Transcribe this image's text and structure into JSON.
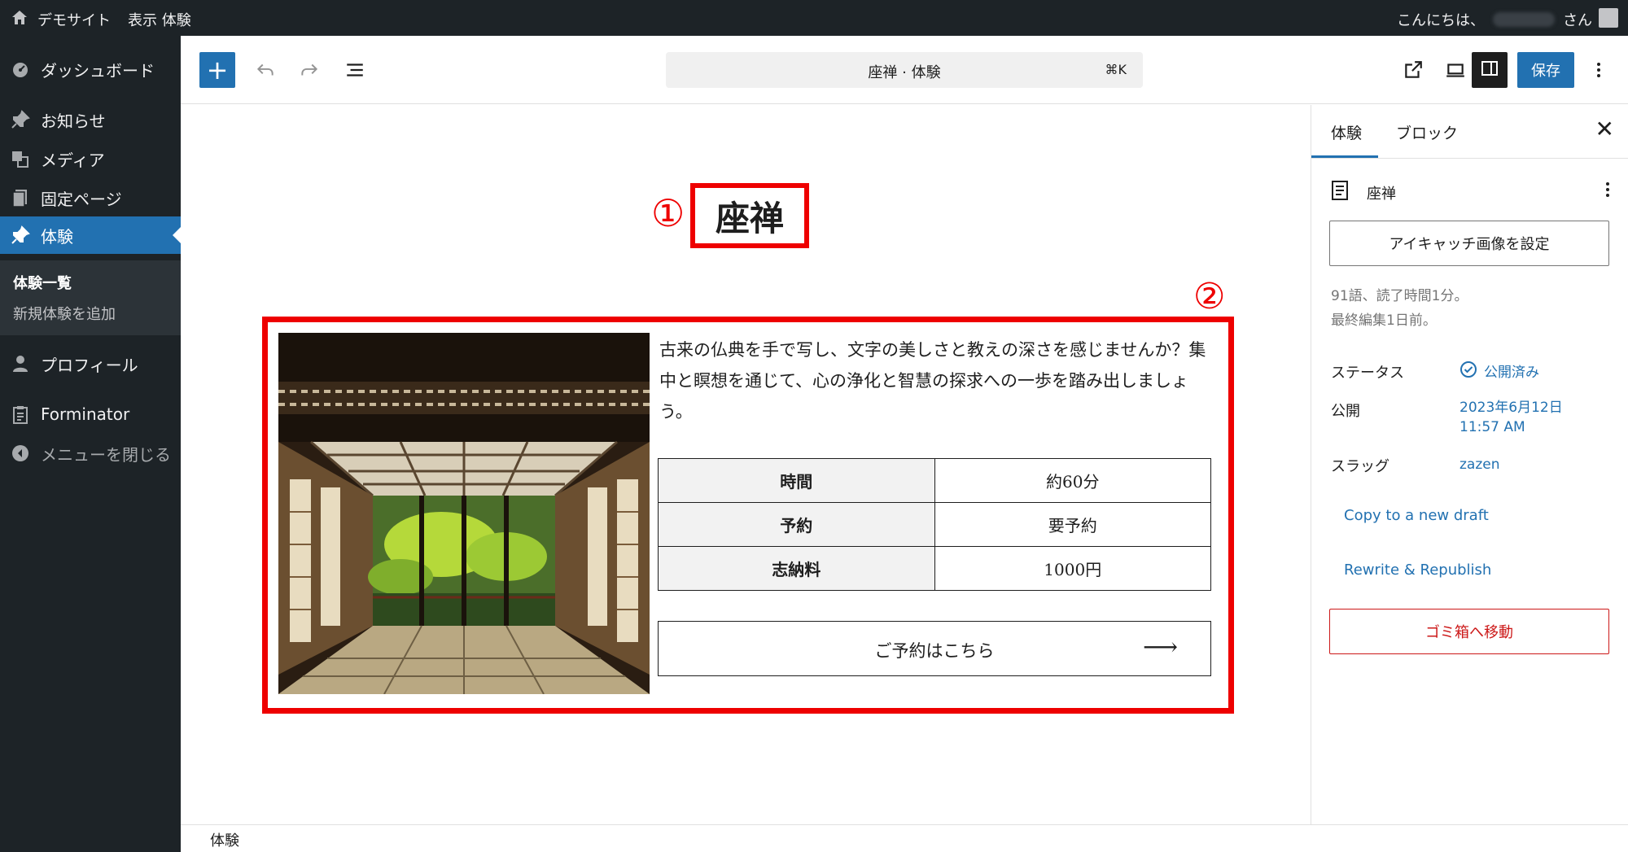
{
  "admin_bar": {
    "site_name": "デモサイト",
    "view_link": "表示 体験",
    "greeting_prefix": "こんにちは、",
    "greeting_suffix": "さん"
  },
  "sidebar": {
    "items": [
      {
        "label": "ダッシュボード",
        "icon": "dashboard-icon"
      },
      {
        "label": "お知らせ",
        "icon": "pin-icon"
      },
      {
        "label": "メディア",
        "icon": "media-icon"
      },
      {
        "label": "固定ページ",
        "icon": "pages-icon"
      },
      {
        "label": "体験",
        "icon": "pin-icon"
      },
      {
        "label": "プロフィール",
        "icon": "user-icon"
      },
      {
        "label": "Forminator",
        "icon": "clipboard-icon"
      },
      {
        "label": "メニューを閉じる",
        "icon": "collapse-icon"
      }
    ],
    "submenu": {
      "item1": "体験一覧",
      "item2": "新規体験を追加"
    }
  },
  "toolbar": {
    "add_label": "+",
    "command_title": "座禅 · 体験",
    "command_shortcut": "⌘K",
    "save_label": "保存"
  },
  "canvas": {
    "marker1": "①",
    "marker2": "②",
    "post_title": "座禅",
    "intro_text": "古来の仏典を手で写し、文字の美しさと教えの深さを感じませんか？集中と瞑想を通じて、心の浄化と智慧の探求への一歩を踏み出しましょう。",
    "table": [
      {
        "key": "時間",
        "value": "約60分"
      },
      {
        "key": "予約",
        "value": "要予約"
      },
      {
        "key": "志納料",
        "value": "1000円"
      }
    ],
    "reserve_label": "ご予約はこちら",
    "reserve_arrow": "⟶"
  },
  "footer": {
    "breadcrumb": "体験"
  },
  "settings": {
    "tab1": "体験",
    "tab2": "ブロック",
    "close": "✕",
    "doc_title": "座禅",
    "featured_image_btn": "アイキャッチ画像を設定",
    "meta_line1": "91語、読了時間1分。",
    "meta_line2": "最終編集1日前。",
    "status_label": "ステータス",
    "status_value": "公開済み",
    "publish_label": "公開",
    "publish_date": "2023年6月12日",
    "publish_time": "11:57 AM",
    "slug_label": "スラッグ",
    "slug_value": "zazen",
    "copy_draft": "Copy to a new draft",
    "rewrite": "Rewrite & Republish",
    "trash": "ゴミ箱へ移動"
  },
  "colors": {
    "accent": "#2271b1",
    "admin_bg": "#1d2327",
    "annotation_red": "#ee0000",
    "trash_red": "#cc1818"
  }
}
